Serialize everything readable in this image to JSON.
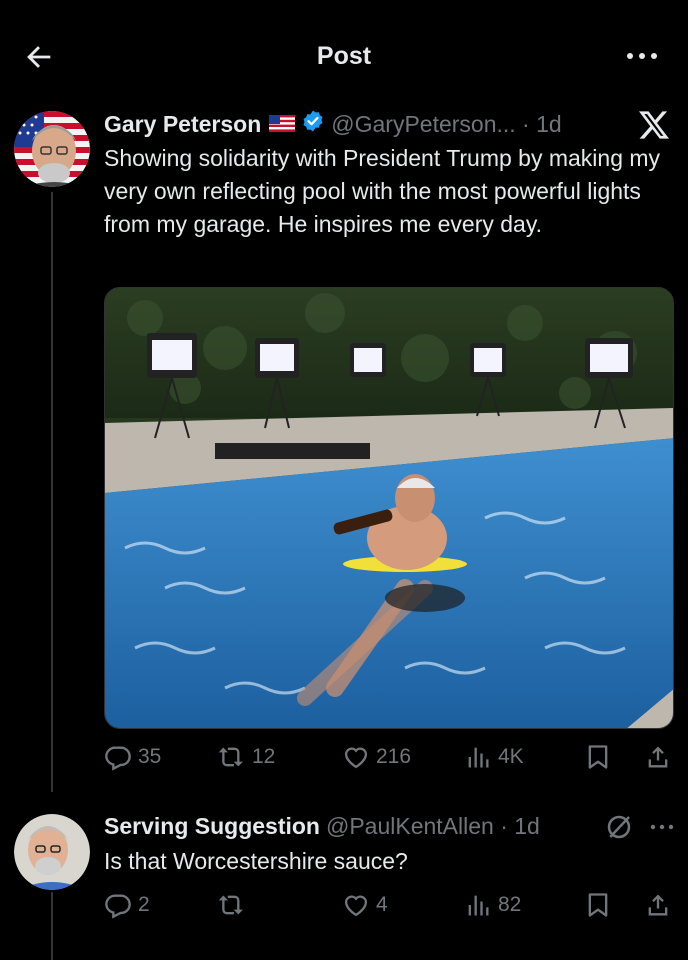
{
  "header": {
    "title": "Post",
    "back_icon": "arrow-left-icon",
    "more_icon": "ellipsis-icon"
  },
  "post": {
    "author_name": "Gary Peterson",
    "flag": "🇺🇸",
    "handle_time": "@GaryPeterson... · 1d",
    "text": "Showing solidarity with President Trump by making my very own reflecting pool with the most powerful lights from my garage.  He inspires me every day.",
    "media_icon": "pool-photo",
    "stats": {
      "replies": "35",
      "reposts": "12",
      "likes": "216",
      "views": "4K"
    }
  },
  "reply": {
    "author_name": "Serving Suggestion",
    "handle_time": "@PaulKentAllen · 1d",
    "text": "Is that Worcestershire sauce?",
    "stats": {
      "replies": "2",
      "reposts": "",
      "likes": "4",
      "views": "82"
    }
  },
  "colors": {
    "background": "#000000",
    "text": "#e7e9ea",
    "muted": "#71767b",
    "verified": "#1d9bf0"
  }
}
